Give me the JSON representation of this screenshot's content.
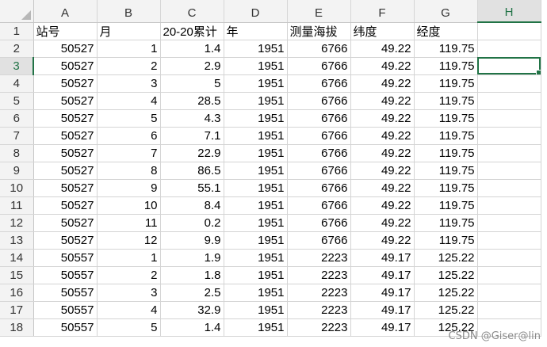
{
  "columns": [
    "A",
    "B",
    "C",
    "D",
    "E",
    "F",
    "G",
    "H"
  ],
  "active_column": "H",
  "active_row": "3",
  "header_row": {
    "row_number": "1",
    "cells": [
      "站号",
      "月",
      "20-20累计",
      "年",
      "测量海拔",
      "纬度",
      "经度",
      ""
    ]
  },
  "rows": [
    {
      "row_number": "2",
      "cells": [
        "50527",
        "1",
        "1.4",
        "1951",
        "6766",
        "49.22",
        "119.75",
        ""
      ]
    },
    {
      "row_number": "3",
      "cells": [
        "50527",
        "2",
        "2.9",
        "1951",
        "6766",
        "49.22",
        "119.75",
        ""
      ]
    },
    {
      "row_number": "4",
      "cells": [
        "50527",
        "3",
        "5",
        "1951",
        "6766",
        "49.22",
        "119.75",
        ""
      ]
    },
    {
      "row_number": "5",
      "cells": [
        "50527",
        "4",
        "28.5",
        "1951",
        "6766",
        "49.22",
        "119.75",
        ""
      ]
    },
    {
      "row_number": "6",
      "cells": [
        "50527",
        "5",
        "4.3",
        "1951",
        "6766",
        "49.22",
        "119.75",
        ""
      ]
    },
    {
      "row_number": "7",
      "cells": [
        "50527",
        "6",
        "7.1",
        "1951",
        "6766",
        "49.22",
        "119.75",
        ""
      ]
    },
    {
      "row_number": "8",
      "cells": [
        "50527",
        "7",
        "22.9",
        "1951",
        "6766",
        "49.22",
        "119.75",
        ""
      ]
    },
    {
      "row_number": "9",
      "cells": [
        "50527",
        "8",
        "86.5",
        "1951",
        "6766",
        "49.22",
        "119.75",
        ""
      ]
    },
    {
      "row_number": "10",
      "cells": [
        "50527",
        "9",
        "55.1",
        "1951",
        "6766",
        "49.22",
        "119.75",
        ""
      ]
    },
    {
      "row_number": "11",
      "cells": [
        "50527",
        "10",
        "8.4",
        "1951",
        "6766",
        "49.22",
        "119.75",
        ""
      ]
    },
    {
      "row_number": "12",
      "cells": [
        "50527",
        "11",
        "0.2",
        "1951",
        "6766",
        "49.22",
        "119.75",
        ""
      ]
    },
    {
      "row_number": "13",
      "cells": [
        "50527",
        "12",
        "9.9",
        "1951",
        "6766",
        "49.22",
        "119.75",
        ""
      ]
    },
    {
      "row_number": "14",
      "cells": [
        "50557",
        "1",
        "1.9",
        "1951",
        "2223",
        "49.17",
        "125.22",
        ""
      ]
    },
    {
      "row_number": "15",
      "cells": [
        "50557",
        "2",
        "1.8",
        "1951",
        "2223",
        "49.17",
        "125.22",
        ""
      ]
    },
    {
      "row_number": "16",
      "cells": [
        "50557",
        "3",
        "2.5",
        "1951",
        "2223",
        "49.17",
        "125.22",
        ""
      ]
    },
    {
      "row_number": "17",
      "cells": [
        "50557",
        "4",
        "32.9",
        "1951",
        "2223",
        "49.17",
        "125.22",
        ""
      ]
    },
    {
      "row_number": "18",
      "cells": [
        "50557",
        "5",
        "1.4",
        "1951",
        "2223",
        "49.17",
        "125.22",
        ""
      ]
    }
  ],
  "watermark": "CSDN @Giser@lin",
  "colors": {
    "accent": "#217346",
    "header_bg": "#f3f3f3",
    "gridline": "#d4d4d4"
  }
}
